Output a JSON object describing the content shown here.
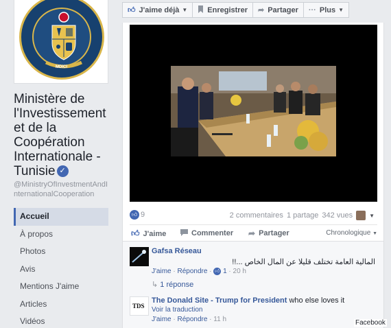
{
  "page": {
    "name": "Ministère de l'Investissement et de la Coopération Internationale - Tunisie",
    "handle": "@MinistryOfInvestmentAndInternationalCooperation",
    "seal_text": "MDICI"
  },
  "nav": [
    {
      "label": "Accueil",
      "active": true
    },
    {
      "label": "À propos",
      "active": false
    },
    {
      "label": "Photos",
      "active": false
    },
    {
      "label": "Avis",
      "active": false
    },
    {
      "label": "Mentions J'aime",
      "active": false
    },
    {
      "label": "Articles",
      "active": false
    },
    {
      "label": "Vidéos",
      "active": false
    }
  ],
  "actionbar": {
    "like_label": "J'aime déjà",
    "save_label": "Enregistrer",
    "share_label": "Partager",
    "more_label": "Plus"
  },
  "post": {
    "like_count": "9",
    "comments_count": "2 commentaires",
    "shares_count": "1 partage",
    "views": "342 vues",
    "actions": {
      "like": "J'aime",
      "comment": "Commenter",
      "share": "Partager"
    },
    "sort": "Chronologique"
  },
  "comments": [
    {
      "author": "Gafsa Réseau",
      "text": "المالية العامة تختلف قليلا عن المال الخاص ...!!",
      "like_label": "J'aime",
      "reply_label": "Répondre",
      "reactions": "1",
      "time": "20 h",
      "replies": "1 réponse"
    },
    {
      "author": "The Donald Site - Trump for President",
      "text": "who else loves it",
      "translate": "Voir la traduction",
      "like_label": "J'aime",
      "reply_label": "Répondre",
      "time": "11 h",
      "avatar_text": "TDS"
    }
  ],
  "watermark": "Facebook",
  "colors": {
    "fb_blue": "#4267b2",
    "link_blue": "#365899",
    "background": "#e9ebee"
  }
}
